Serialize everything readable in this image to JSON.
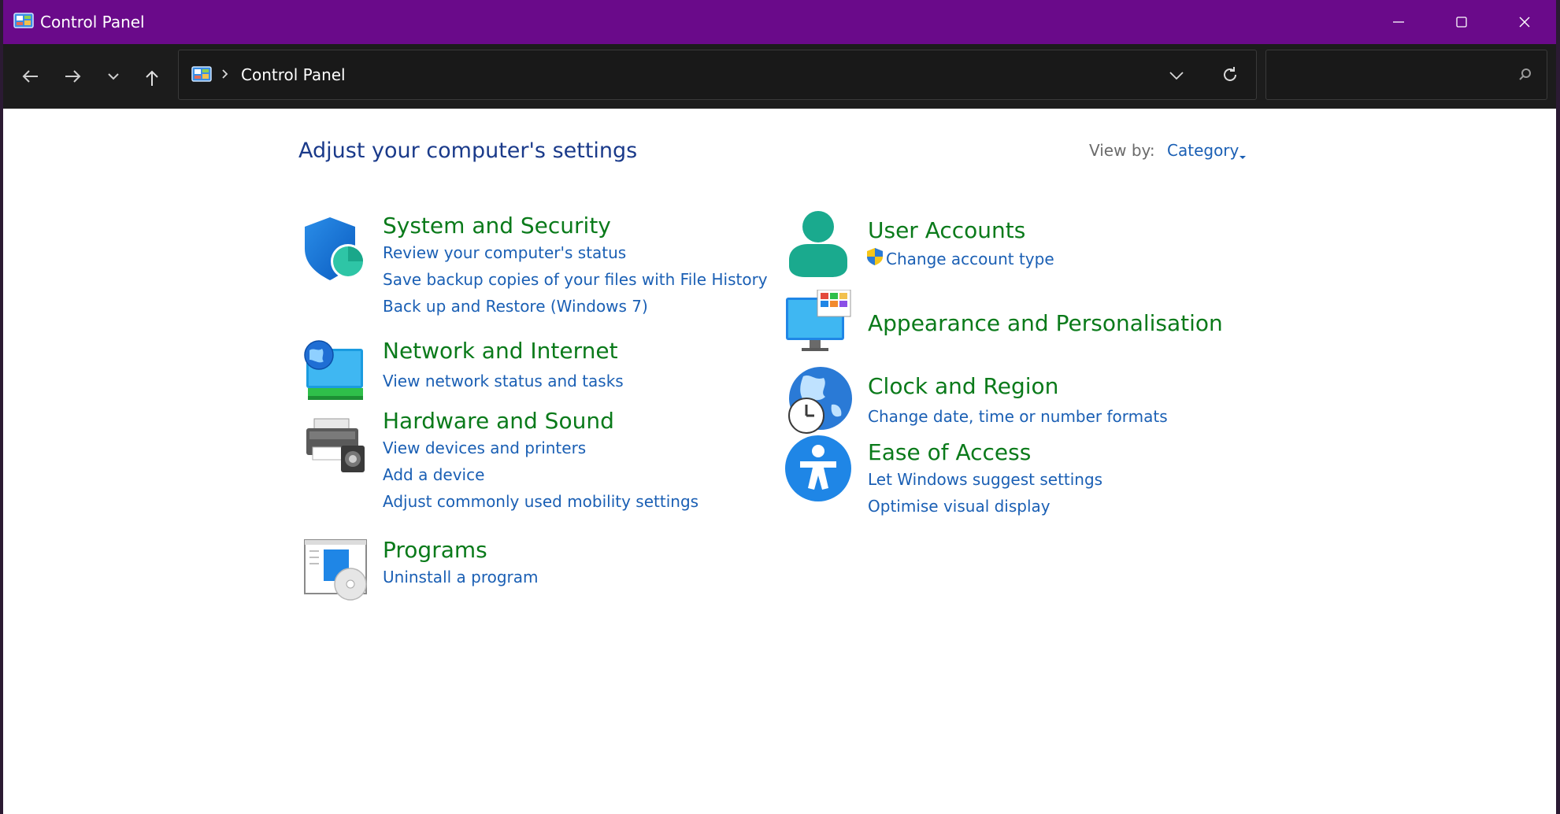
{
  "window": {
    "title": "Control Panel"
  },
  "address": {
    "path": "Control Panel",
    "search_placeholder": ""
  },
  "heading": "Adjust your computer's settings",
  "view_by": {
    "label": "View by:",
    "value": "Category"
  },
  "categories": {
    "system": {
      "title": "System and Security",
      "links": [
        "Review your computer's status",
        "Save backup copies of your files with File History",
        "Back up and Restore (Windows 7)"
      ]
    },
    "network": {
      "title": "Network and Internet",
      "links": [
        "View network status and tasks"
      ]
    },
    "hardware": {
      "title": "Hardware and Sound",
      "links": [
        "View devices and printers",
        "Add a device",
        "Adjust commonly used mobility settings"
      ]
    },
    "programs": {
      "title": "Programs",
      "links": [
        "Uninstall a program"
      ]
    },
    "user": {
      "title": "User Accounts",
      "links": [
        "Change account type"
      ]
    },
    "appearance": {
      "title": "Appearance and Personalisation",
      "links": []
    },
    "clock": {
      "title": "Clock and Region",
      "links": [
        "Change date, time or number formats"
      ]
    },
    "ease": {
      "title": "Ease of Access",
      "links": [
        "Let Windows suggest settings",
        "Optimise visual display"
      ]
    }
  },
  "colors": {
    "titlebar": "#6a0a8a",
    "category_title": "#0a7a1a",
    "link": "#1a5fb4",
    "heading": "#1a3a8a"
  },
  "icons": [
    "control-panel-icon",
    "shield-icon",
    "network-icon",
    "printer-icon",
    "programs-icon",
    "user-icon",
    "uac-shield-icon",
    "monitor-icon",
    "globe-clock-icon",
    "accessibility-icon"
  ]
}
